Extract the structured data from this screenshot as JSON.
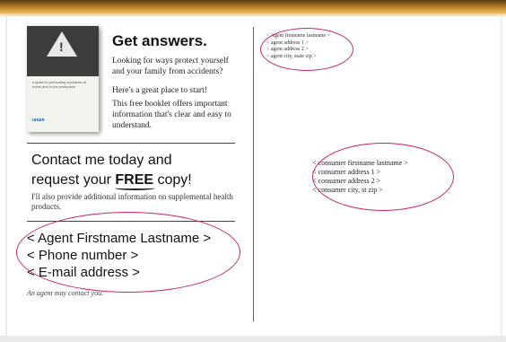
{
  "booklet": {
    "caption": "a guide to preventing accidents at home and in the workplace",
    "logo": "unum"
  },
  "promo": {
    "heading": "Get answers.",
    "para1": "Looking for ways protect yourself and your family from accidents?",
    "para2": "Here's a great place to start!",
    "para3": "This free booklet offers important information that's clear and easy to understand."
  },
  "cta": {
    "line1": "Contact me today and",
    "line2_pre": "request your ",
    "line2_free": "FREE",
    "line2_post": " copy!",
    "supplemental": "I'll also provide additional information on supplemental health products."
  },
  "agent_block": {
    "name": "< Agent Firstname Lastname >",
    "phone": "< Phone number >",
    "email": "< E-mail address >",
    "note": "An agent may contact you."
  },
  "return_address": [
    "< Agent firstname lastname >",
    "< agent address 1 >",
    "< agent address 2 >",
    "< agent city, state zip >"
  ],
  "consumer_address": [
    "< consumer firstname lastname >",
    "< consumer address 1 >",
    "< consumer address 2 >",
    "< consumer city, st zip >"
  ],
  "colors": {
    "highlight_ellipse": "#c8246e",
    "frame_gold": "#c58a2e"
  }
}
